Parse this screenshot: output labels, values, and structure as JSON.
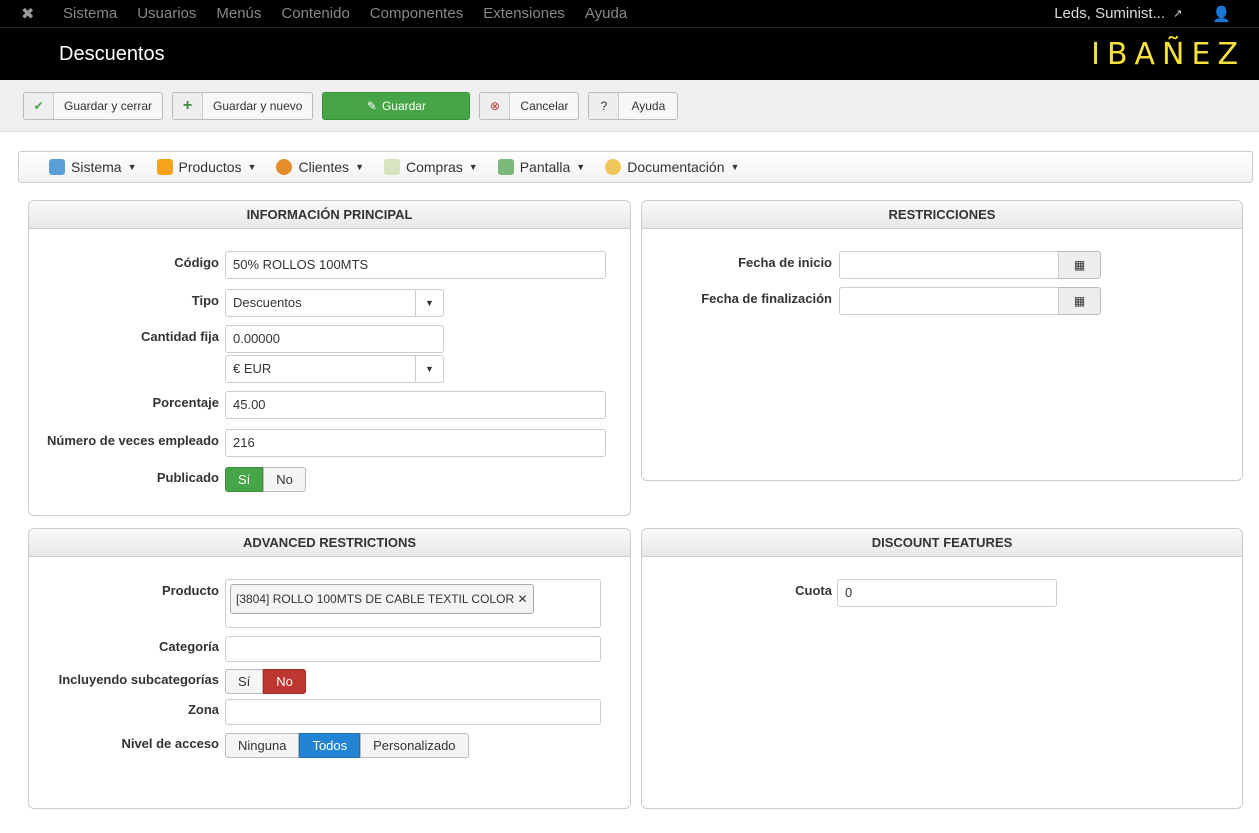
{
  "topnav": {
    "items": [
      "Sistema",
      "Usuarios",
      "Menús",
      "Contenido",
      "Componentes",
      "Extensiones",
      "Ayuda"
    ],
    "site": "Leds, Suminist..."
  },
  "header": {
    "title": "Descuentos",
    "brand": "IBAÑEZ"
  },
  "toolbar": {
    "save_close": "Guardar y cerrar",
    "save_new": "Guardar y nuevo",
    "save": "Guardar",
    "cancel": "Cancelar",
    "help": "Ayuda"
  },
  "menu": {
    "items": [
      "Sistema",
      "Productos",
      "Clientes",
      "Compras",
      "Pantalla",
      "Documentación"
    ]
  },
  "main_info": {
    "title": "INFORMACIÓN PRINCIPAL",
    "codigo_label": "Código",
    "codigo": "50% ROLLOS 100MTS",
    "tipo_label": "Tipo",
    "tipo": "Descuentos",
    "cantidad_label": "Cantidad fija",
    "cantidad": "0.00000",
    "currency": "€ EUR",
    "porcentaje_label": "Porcentaje",
    "porcentaje": "45.00",
    "veces_label": "Número de veces empleado",
    "veces": "216",
    "publicado_label": "Publicado",
    "yes": "Sí",
    "no": "No"
  },
  "restrictions": {
    "title": "RESTRICCIONES",
    "inicio_label": "Fecha de inicio",
    "fin_label": "Fecha de finalización"
  },
  "advanced": {
    "title": "ADVANCED RESTRICTIONS",
    "producto_label": "Producto",
    "producto_chip": "[3804] ROLLO 100MTS DE CABLE TEXTIL COLOR",
    "categoria_label": "Categoría",
    "sub_label": "Incluyendo subcategorías",
    "yes": "Sí",
    "no": "No",
    "zona_label": "Zona",
    "nivel_label": "Nivel de acceso",
    "nivel_options": [
      "Ninguna",
      "Todos",
      "Personalizado"
    ]
  },
  "features": {
    "title": "DISCOUNT FEATURES",
    "cuota_label": "Cuota",
    "cuota": "0"
  }
}
